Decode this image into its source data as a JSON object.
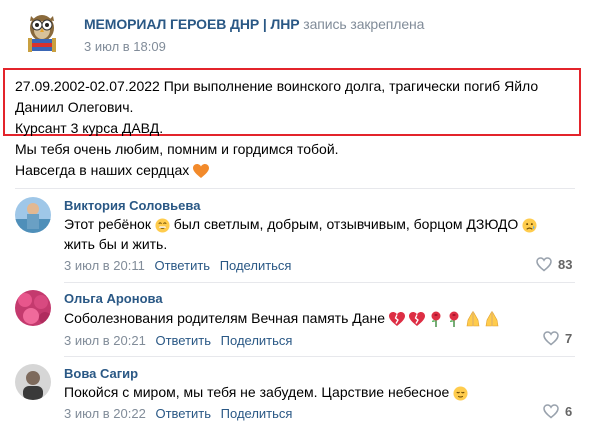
{
  "post": {
    "group_name": "МЕМОРИАЛ ГЕРОЕВ ДНР | ЛНР",
    "pinned_label": "запись закреплена",
    "date": "3 июл в 18:09",
    "lines": [
      "27.09.2002-02.07.2022 При выполнение воинского долга, трагически погиб Яйло",
      "Даниил Олегович.",
      "Курсант 3 курса ДАВД.",
      "Мы тебя очень любим, помним и гордимся тобой.",
      "Навсегда в наших сердцах"
    ]
  },
  "comments": [
    {
      "author": "Виктория Соловьева",
      "text_part1": "Этот ребёнок",
      "text_part2": "был светлым, добрым, отзывчивым, борцом ДЗЮДО",
      "text_line2": "жить бы и жить.",
      "time": "3 июл в 20:11",
      "reply": "Ответить",
      "share": "Поделиться",
      "likes": "83"
    },
    {
      "author": "Ольга Аронова",
      "text": "Соболезнования родителям Вечная память Дане",
      "time": "3 июл в 20:21",
      "reply": "Ответить",
      "share": "Поделиться",
      "likes": "7"
    },
    {
      "author": "Вова Сагир",
      "text": "Покойся с миром, мы тебя не забудем. Царствие небесное",
      "time": "3 июл в 20:22",
      "reply": "Ответить",
      "share": "Поделиться",
      "likes": "6"
    }
  ]
}
